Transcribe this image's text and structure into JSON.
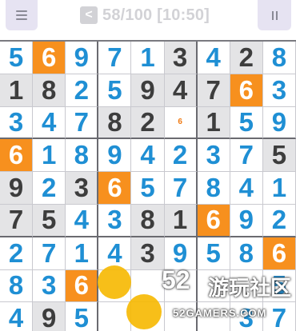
{
  "header": {
    "back_glyph": "<",
    "title": "58/100 [10:50]",
    "menu_icon": "menu-icon",
    "pause_icon": "pause-icon"
  },
  "board": {
    "rows": [
      [
        "5",
        "6",
        "9",
        "7",
        "1",
        "3",
        "4",
        "2",
        "8"
      ],
      [
        "1",
        "8",
        "2",
        "5",
        "9",
        "4",
        "7",
        "6",
        "3"
      ],
      [
        "3",
        "4",
        "7",
        "8",
        "2",
        "6",
        "1",
        "5",
        "9"
      ],
      [
        "6",
        "1",
        "8",
        "9",
        "4",
        "2",
        "3",
        "7",
        "5"
      ],
      [
        "9",
        "2",
        "3",
        "6",
        "5",
        "7",
        "8",
        "4",
        "1"
      ],
      [
        "7",
        "5",
        "4",
        "3",
        "8",
        "1",
        "6",
        "9",
        "2"
      ],
      [
        "2",
        "7",
        "1",
        "4",
        "3",
        "9",
        "5",
        "8",
        "6"
      ],
      [
        "8",
        "3",
        "6",
        "",
        "",
        "",
        "",
        "",
        "5"
      ],
      [
        "4",
        "9",
        "5",
        "",
        "",
        "",
        "",
        "3",
        "7"
      ]
    ],
    "given": [
      [
        0,
        0,
        0,
        0,
        0,
        1,
        0,
        1,
        0
      ],
      [
        1,
        1,
        0,
        0,
        1,
        1,
        1,
        0,
        0
      ],
      [
        0,
        0,
        0,
        1,
        1,
        0,
        1,
        0,
        0
      ],
      [
        0,
        0,
        0,
        0,
        0,
        0,
        0,
        0,
        1
      ],
      [
        1,
        0,
        1,
        0,
        0,
        0,
        0,
        0,
        0
      ],
      [
        1,
        1,
        0,
        0,
        1,
        1,
        0,
        0,
        0
      ],
      [
        0,
        0,
        0,
        0,
        1,
        0,
        0,
        0,
        0
      ],
      [
        0,
        0,
        0,
        0,
        0,
        0,
        0,
        0,
        0
      ],
      [
        0,
        1,
        0,
        0,
        0,
        0,
        0,
        0,
        0
      ]
    ],
    "highlighted": [
      [
        0,
        1
      ],
      [
        1,
        7
      ],
      [
        3,
        0
      ],
      [
        4,
        3
      ],
      [
        5,
        6
      ],
      [
        6,
        8
      ],
      [
        7,
        2
      ]
    ],
    "note_cell": [
      2,
      5
    ],
    "colors": {
      "highlight": "#f7901e",
      "user_digit": "#1f8fd4",
      "given_bg": "#e4e4e6",
      "given_digit": "#3d3d3d"
    }
  },
  "watermark": {
    "number": "52",
    "cn": "游玩社区",
    "domain": "52GAMERS.COM"
  }
}
